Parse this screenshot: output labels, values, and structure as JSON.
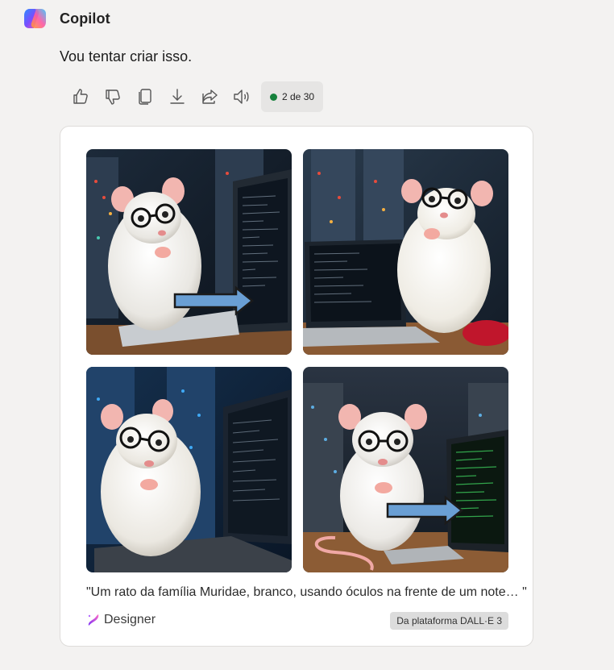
{
  "header": {
    "brand": "Copilot",
    "logo_icon": "copilot-logo-icon"
  },
  "message": {
    "text": "Vou tentar criar isso."
  },
  "actions": {
    "icons": [
      "thumbs-up-icon",
      "thumbs-down-icon",
      "copy-icon",
      "download-icon",
      "share-icon",
      "speaker-icon"
    ],
    "counter": "2 de 30",
    "counter_dot_color": "#16813c"
  },
  "card": {
    "caption": "\"Um rato da família Muridae, branco, usando óculos na frente de um note…  \"",
    "designer_label": "Designer",
    "platform_badge": "Da plataforma DALL·E 3",
    "images": [
      {
        "subject": "white-rat-glasses-laptop",
        "has_arrow": true
      },
      {
        "subject": "white-rat-glasses-laptop",
        "has_arrow": false
      },
      {
        "subject": "white-rat-glasses-laptop",
        "has_arrow": false
      },
      {
        "subject": "white-rat-glasses-laptop",
        "has_arrow": true
      }
    ],
    "arrow_color": "#6a9fd4"
  }
}
